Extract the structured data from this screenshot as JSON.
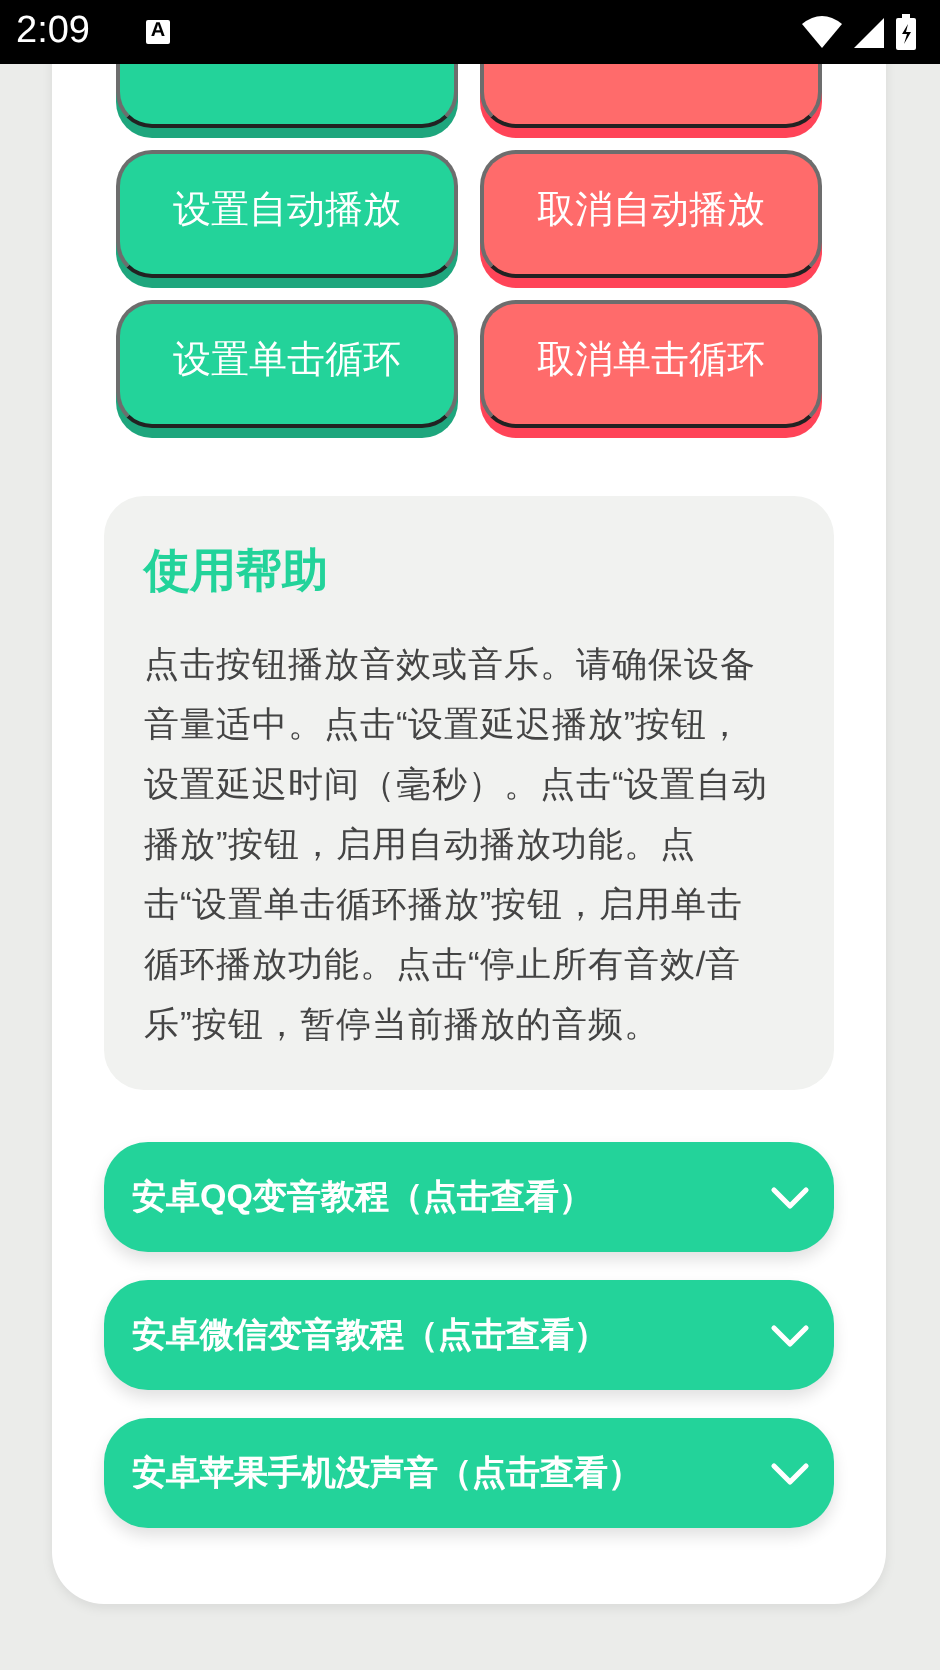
{
  "status_bar": {
    "time": "2:09",
    "notification": "A"
  },
  "buttons": [
    {
      "kind": "set"
    },
    {
      "kind": "cancel"
    },
    {
      "label": "设置自动播放",
      "kind": "set"
    },
    {
      "label": "取消自动播放",
      "kind": "cancel"
    },
    {
      "label": "设置单击循环",
      "kind": "set"
    },
    {
      "label": "取消单击循环",
      "kind": "cancel"
    }
  ],
  "help": {
    "title": "使用帮助",
    "text": "点击按钮播放音效或音乐。请确保设备音量适中。点击“设置延迟播放”按钮，设置延迟时间（毫秒）。点击“设置自动播放”按钮，启用自动播放功能。点击“设置单击循环播放”按钮，启用单击循环播放功能。点击“停止所有音效/音乐”按钮，暂停当前播放的音频。"
  },
  "accordions": [
    {
      "title": "安卓QQ变音教程（点击查看）",
      "expanded": false
    },
    {
      "title": "安卓微信变音教程（点击查看）",
      "expanded": false
    },
    {
      "title": "安卓苹果手机没声音（点击查看）",
      "expanded": false
    }
  ]
}
